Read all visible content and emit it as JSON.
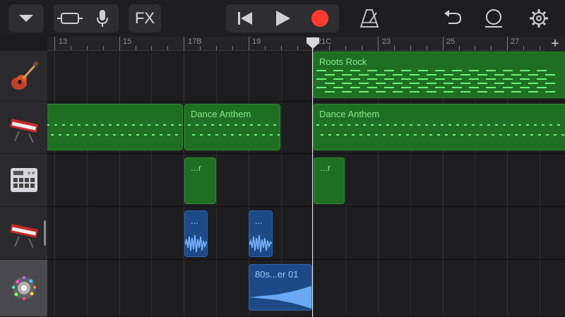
{
  "toolbar": {
    "fx_label": "FX",
    "buttons": [
      "browser-dropdown",
      "tracks-view",
      "microphone",
      "fx",
      "go-to-beginning",
      "play",
      "record",
      "metronome",
      "undo",
      "loop",
      "settings"
    ]
  },
  "ruler": {
    "labels": [
      "13",
      "15",
      "17B",
      "19",
      "21C",
      "23",
      "25",
      "27"
    ],
    "add_label": "+"
  },
  "tracks": [
    {
      "instrument": "guitar-icon"
    },
    {
      "instrument": "keyboard-icon"
    },
    {
      "instrument": "drum-machine-icon"
    },
    {
      "instrument": "keyboard-icon"
    },
    {
      "instrument": "sampler-sparkle-icon"
    }
  ],
  "regions": {
    "roots_rock": "Roots Rock",
    "dance_anthem_1": "Dance Anthem",
    "dance_anthem_2": "Dance Anthem",
    "drum_1": "...r",
    "drum_2": "...r",
    "audio_1": "...",
    "audio_2": "...",
    "audio_3": "80s...er 01"
  },
  "colors": {
    "midi_region": "#1f6f22",
    "audio_region": "#1d4a86",
    "record": "#ff3b30"
  }
}
